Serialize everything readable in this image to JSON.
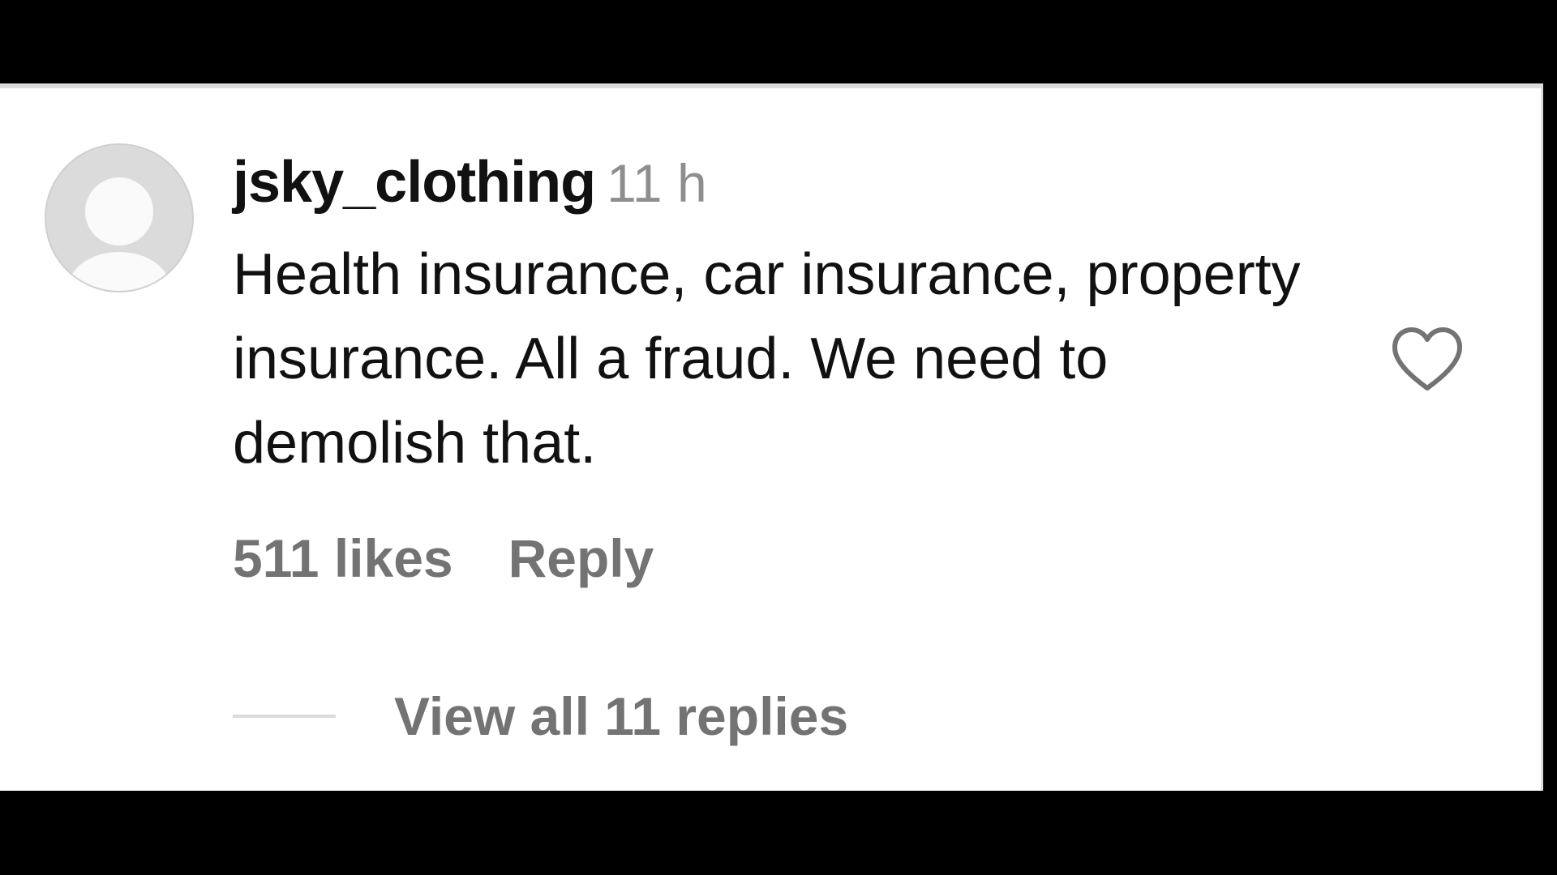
{
  "comment": {
    "username": "jsky_clothing",
    "timestamp": "11 h",
    "text": "Health insurance, car insurance, property insurance. All a fraud. We need to demolish that.",
    "likes": "511 likes",
    "reply_label": "Reply",
    "view_replies_label": "View all 11 replies",
    "avatar_icon": "default-avatar-icon",
    "like_icon": "heart-outline-icon"
  },
  "colors": {
    "username": "#111111",
    "secondary_text": "#737373",
    "timestamp": "#8e8e8e",
    "avatar_bg": "#dbdbdb",
    "heart_stroke": "#737373"
  }
}
